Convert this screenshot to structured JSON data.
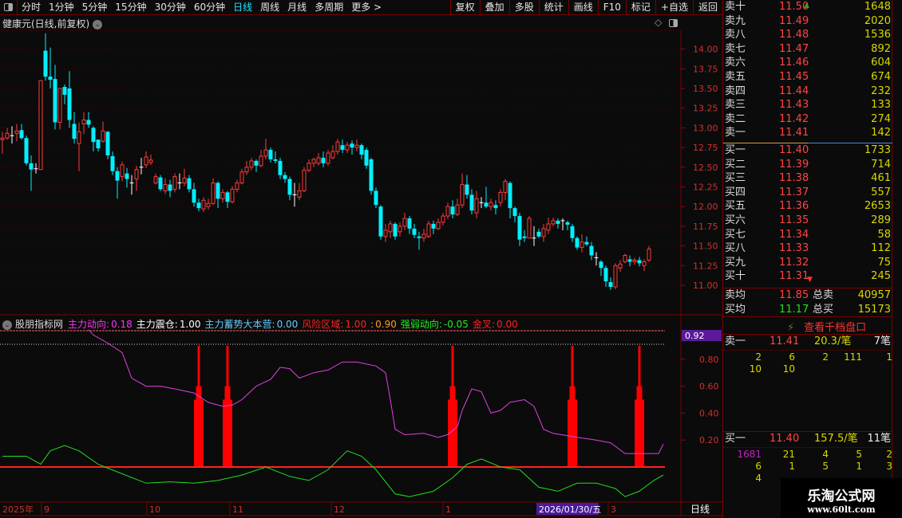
{
  "toolbar": {
    "periods": [
      "分时",
      "1分钟",
      "5分钟",
      "15分钟",
      "30分钟",
      "60分钟",
      "日线",
      "周线",
      "月线",
      "多周期",
      "更多 >"
    ],
    "active_period": "日线",
    "actions": [
      "复权",
      "叠加",
      "多股",
      "统计",
      "画线",
      "F10",
      "标记",
      "+自选",
      "返回"
    ]
  },
  "chart": {
    "title": "健康元(日线,前复权)",
    "y_ticks": [
      "14.00",
      "13.75",
      "13.50",
      "13.25",
      "13.00",
      "12.75",
      "12.50",
      "12.25",
      "12.00",
      "11.75",
      "11.50",
      "11.25",
      "11.00"
    ]
  },
  "indicator": {
    "name": "股朋指标网",
    "items": [
      {
        "label": "主力动向:",
        "value": "0.18",
        "color": "#ff33ff"
      },
      {
        "label": "主力震仓:",
        "value": "1.00",
        "color": "#ffffff"
      },
      {
        "label": "主力蓄势大本营:",
        "value": "0.00",
        "color": "#66ccff"
      },
      {
        "label": "风险区域:",
        "value": "1.00",
        "color": "#ff2222"
      },
      {
        "label": ":",
        "value": "0.90",
        "color": "#ff9922"
      },
      {
        "label": "强弱动向:",
        "value": "-0.05",
        "color": "#22ee22"
      },
      {
        "label": "金叉:",
        "value": "0.00",
        "color": "#ff2222"
      }
    ],
    "y_ticks": [
      "0.80",
      "0.60",
      "0.40",
      "0.20"
    ],
    "current_label": "0.92"
  },
  "date_axis": {
    "labels": [
      "2025年",
      "9",
      "10",
      "11",
      "12",
      "1",
      "3"
    ],
    "cursor_date": "2026/01/30/五",
    "period": "日线"
  },
  "chart_data": {
    "type": "candlestick",
    "title": "健康元(日线,前复权)",
    "ylim": [
      10.8,
      14.3
    ],
    "colors": {
      "up": "#ff3b3b",
      "down": "#00f0ff",
      "doji": "#ffffff",
      "main_force": "#e040e0",
      "strength": "#22dd22",
      "spike": "#ff0000"
    },
    "candles": [
      [
        12.85,
        12.87,
        12.95,
        12.67
      ],
      [
        12.87,
        12.93,
        13.0,
        12.85
      ],
      [
        12.9,
        12.9,
        13.02,
        12.8
      ],
      [
        12.93,
        12.96,
        13.05,
        12.83
      ],
      [
        12.97,
        12.87,
        13.05,
        12.85
      ],
      [
        12.87,
        12.55,
        12.9,
        12.52
      ],
      [
        12.55,
        12.47,
        12.65,
        12.2
      ],
      [
        12.48,
        12.48,
        12.55,
        12.42
      ],
      [
        12.47,
        13.6,
        13.6,
        12.47
      ],
      [
        13.98,
        13.65,
        14.2,
        13.6
      ],
      [
        13.65,
        13.61,
        14.02,
        13.5
      ],
      [
        13.62,
        13.07,
        13.8,
        12.98
      ],
      [
        13.07,
        13.5,
        13.5,
        12.98
      ],
      [
        13.52,
        13.42,
        13.55,
        13.3
      ],
      [
        13.5,
        13.1,
        13.72,
        13.0
      ],
      [
        13.05,
        12.86,
        13.2,
        12.8
      ],
      [
        12.8,
        12.95,
        13.07,
        12.45
      ],
      [
        13.05,
        13.1,
        13.2,
        12.92
      ],
      [
        13.1,
        13.04,
        13.2,
        13.0
      ],
      [
        13.0,
        12.82,
        13.02,
        12.7
      ],
      [
        12.85,
        12.74,
        12.85,
        12.7
      ],
      [
        12.83,
        12.96,
        13.08,
        12.81
      ],
      [
        12.95,
        12.65,
        12.96,
        12.6
      ],
      [
        12.64,
        12.45,
        12.7,
        12.4
      ],
      [
        12.45,
        12.33,
        12.5,
        12.1
      ],
      [
        12.38,
        12.53,
        12.57,
        12.32
      ],
      [
        12.42,
        12.35,
        12.49,
        12.24
      ],
      [
        12.3,
        12.3,
        12.4,
        12.15
      ],
      [
        12.35,
        12.47,
        12.52,
        12.2
      ],
      [
        12.5,
        12.5,
        12.62,
        12.41
      ],
      [
        12.53,
        12.63,
        12.7,
        12.49
      ],
      [
        12.56,
        12.59,
        12.66,
        12.53
      ],
      [
        12.3,
        12.38,
        12.42,
        12.28
      ],
      [
        12.37,
        12.22,
        12.4,
        12.2
      ],
      [
        12.2,
        12.28,
        12.36,
        12.16
      ],
      [
        12.28,
        12.2,
        12.34,
        12.12
      ],
      [
        12.22,
        12.38,
        12.42,
        12.18
      ],
      [
        12.3,
        12.3,
        12.42,
        12.22
      ],
      [
        12.3,
        12.36,
        12.48,
        12.26
      ],
      [
        12.36,
        12.22,
        12.4,
        12.18
      ],
      [
        12.22,
        12.05,
        12.3,
        12.0
      ],
      [
        12.05,
        11.98,
        12.1,
        11.94
      ],
      [
        11.97,
        12.08,
        12.12,
        11.93
      ],
      [
        12.0,
        12.04,
        12.1,
        11.96
      ],
      [
        12.04,
        12.3,
        12.36,
        12.02
      ],
      [
        12.3,
        12.1,
        12.32,
        11.98
      ],
      [
        12.1,
        12.18,
        12.22,
        12.05
      ],
      [
        12.18,
        12.06,
        12.2,
        11.98
      ],
      [
        12.06,
        12.22,
        12.26,
        12.04
      ],
      [
        12.22,
        12.3,
        12.34,
        12.18
      ],
      [
        12.3,
        12.44,
        12.48,
        12.28
      ],
      [
        12.44,
        12.5,
        12.58,
        12.4
      ],
      [
        12.5,
        12.58,
        12.62,
        12.46
      ],
      [
        12.58,
        12.52,
        12.6,
        12.44
      ],
      [
        12.52,
        12.64,
        12.72,
        12.5
      ],
      [
        12.64,
        12.72,
        12.86,
        12.6
      ],
      [
        12.72,
        12.6,
        12.75,
        12.56
      ],
      [
        12.6,
        12.58,
        12.7,
        12.55
      ],
      [
        12.58,
        12.4,
        12.62,
        12.35
      ],
      [
        12.4,
        12.35,
        12.44,
        12.3
      ],
      [
        12.35,
        12.15,
        12.38,
        12.08
      ],
      [
        12.15,
        12.15,
        12.3,
        12.0
      ],
      [
        12.12,
        12.2,
        12.3,
        12.08
      ],
      [
        12.2,
        12.46,
        12.5,
        12.18
      ],
      [
        12.46,
        12.55,
        12.6,
        12.44
      ],
      [
        12.55,
        12.6,
        12.62,
        12.5
      ],
      [
        12.55,
        12.62,
        12.68,
        12.52
      ],
      [
        12.62,
        12.55,
        12.7,
        12.5
      ],
      [
        12.55,
        12.68,
        12.72,
        12.52
      ],
      [
        12.62,
        12.7,
        12.78,
        12.6
      ],
      [
        12.7,
        12.82,
        12.86,
        12.66
      ],
      [
        12.78,
        12.72,
        12.85,
        12.68
      ],
      [
        12.72,
        12.78,
        12.82,
        12.68
      ],
      [
        12.8,
        12.75,
        12.84,
        12.66
      ],
      [
        12.75,
        12.78,
        12.85,
        12.7
      ],
      [
        12.78,
        12.66,
        12.8,
        12.6
      ],
      [
        12.72,
        12.52,
        12.75,
        12.48
      ],
      [
        12.6,
        12.2,
        12.62,
        12.15
      ],
      [
        12.2,
        12.02,
        12.24,
        11.98
      ],
      [
        12.0,
        11.62,
        12.02,
        11.58
      ],
      [
        11.62,
        11.7,
        11.78,
        11.55
      ],
      [
        11.68,
        11.78,
        11.82,
        11.6
      ],
      [
        11.78,
        11.62,
        11.8,
        11.58
      ],
      [
        11.68,
        11.75,
        11.8,
        11.62
      ],
      [
        11.75,
        11.85,
        11.92,
        11.7
      ],
      [
        11.85,
        11.72,
        11.88,
        11.65
      ],
      [
        11.72,
        11.64,
        11.78,
        11.6
      ],
      [
        11.62,
        11.6,
        11.68,
        11.45
      ],
      [
        11.6,
        11.65,
        11.72,
        11.55
      ],
      [
        11.62,
        11.78,
        11.82,
        11.6
      ],
      [
        11.78,
        11.72,
        11.82,
        11.65
      ],
      [
        11.72,
        11.8,
        11.85,
        11.7
      ],
      [
        11.8,
        11.88,
        11.92,
        11.76
      ],
      [
        11.88,
        12.0,
        12.05,
        11.84
      ],
      [
        12.0,
        11.9,
        12.08,
        11.85
      ],
      [
        11.9,
        12.02,
        12.1,
        11.88
      ],
      [
        12.02,
        12.28,
        12.42,
        11.98
      ],
      [
        12.28,
        12.15,
        12.4,
        12.1
      ],
      [
        12.15,
        11.95,
        12.22,
        11.9
      ],
      [
        11.92,
        12.1,
        12.2,
        11.85
      ],
      [
        12.05,
        12.05,
        12.12,
        11.98
      ],
      [
        12.05,
        12.0,
        12.25,
        11.98
      ],
      [
        12.0,
        12.05,
        12.1,
        11.95
      ],
      [
        12.02,
        11.98,
        12.08,
        11.9
      ],
      [
        12.05,
        12.18,
        12.22,
        12.0
      ],
      [
        12.18,
        12.32,
        12.35,
        12.08
      ],
      [
        12.3,
        11.98,
        12.32,
        11.85
      ],
      [
        11.98,
        11.88,
        12.0,
        11.8
      ],
      [
        11.88,
        11.58,
        11.92,
        11.5
      ],
      [
        11.62,
        11.6,
        11.7,
        11.55
      ],
      [
        11.6,
        11.85,
        11.88,
        11.62
      ],
      [
        11.6,
        11.6,
        11.75,
        11.5
      ],
      [
        11.68,
        11.62,
        11.72,
        11.6
      ],
      [
        11.62,
        11.72,
        11.78,
        11.55
      ],
      [
        11.7,
        11.78,
        11.86,
        11.65
      ],
      [
        11.78,
        11.82,
        11.86,
        11.75
      ],
      [
        11.82,
        11.78,
        11.85,
        11.72
      ],
      [
        11.82,
        11.82,
        11.85,
        11.7
      ],
      [
        11.8,
        11.77,
        11.82,
        11.7
      ],
      [
        11.75,
        11.6,
        11.78,
        11.55
      ],
      [
        11.6,
        11.48,
        11.62,
        11.45
      ],
      [
        11.48,
        11.55,
        11.65,
        11.42
      ],
      [
        11.55,
        11.52,
        11.62,
        11.5
      ],
      [
        11.5,
        11.38,
        11.55,
        11.32
      ],
      [
        11.35,
        11.35,
        11.42,
        11.25
      ],
      [
        11.3,
        11.22,
        11.32,
        11.12
      ],
      [
        11.22,
        11.05,
        11.25,
        10.98
      ],
      [
        11.04,
        10.98,
        11.1,
        10.94
      ],
      [
        10.98,
        11.25,
        11.28,
        10.95
      ],
      [
        11.22,
        11.27,
        11.32,
        11.17
      ],
      [
        11.3,
        11.38,
        11.4,
        11.28
      ],
      [
        11.33,
        11.3,
        11.38,
        11.24
      ],
      [
        11.3,
        11.32,
        11.35,
        11.26
      ],
      [
        11.32,
        11.28,
        11.36,
        11.24
      ],
      [
        11.25,
        11.3,
        11.33,
        11.18
      ],
      [
        11.32,
        11.46,
        11.5,
        11.3
      ]
    ],
    "main_force_trend": [
      [
        18,
        1.02
      ],
      [
        19,
        0.98
      ],
      [
        22,
        0.92
      ],
      [
        25,
        0.85
      ],
      [
        27,
        0.66
      ],
      [
        30,
        0.6
      ],
      [
        33,
        0.6
      ],
      [
        36,
        0.58
      ],
      [
        40,
        0.55
      ],
      [
        43,
        0.48
      ],
      [
        46,
        0.45
      ],
      [
        48,
        0.46
      ],
      [
        50,
        0.5
      ],
      [
        53,
        0.6
      ],
      [
        56,
        0.65
      ],
      [
        58,
        0.74
      ],
      [
        60,
        0.73
      ],
      [
        62,
        0.66
      ],
      [
        65,
        0.7
      ],
      [
        68,
        0.72
      ],
      [
        71,
        0.78
      ],
      [
        74,
        0.78
      ],
      [
        78,
        0.75
      ],
      [
        80,
        0.7
      ],
      [
        81,
        0.5
      ],
      [
        82,
        0.28
      ],
      [
        84,
        0.24
      ],
      [
        88,
        0.25
      ],
      [
        91,
        0.22
      ],
      [
        93,
        0.24
      ],
      [
        95,
        0.3
      ],
      [
        96,
        0.42
      ],
      [
        98,
        0.58
      ],
      [
        100,
        0.56
      ],
      [
        102,
        0.4
      ],
      [
        104,
        0.42
      ],
      [
        106,
        0.48
      ],
      [
        109,
        0.5
      ],
      [
        111,
        0.45
      ],
      [
        113,
        0.28
      ],
      [
        115,
        0.25
      ],
      [
        120,
        0.22
      ],
      [
        124,
        0.2
      ],
      [
        127,
        0.18
      ],
      [
        130,
        0.1
      ],
      [
        137,
        0.1
      ],
      [
        138,
        0.17
      ]
    ],
    "strength_trend": [
      [
        0,
        0.08
      ],
      [
        5,
        0.08
      ],
      [
        8,
        0.02
      ],
      [
        10,
        0.12
      ],
      [
        13,
        0.16
      ],
      [
        16,
        0.12
      ],
      [
        20,
        0.02
      ],
      [
        25,
        -0.05
      ],
      [
        30,
        -0.12
      ],
      [
        35,
        -0.11
      ],
      [
        40,
        -0.12
      ],
      [
        45,
        -0.1
      ],
      [
        50,
        -0.06
      ],
      [
        55,
        0.0
      ],
      [
        60,
        -0.07
      ],
      [
        64,
        -0.1
      ],
      [
        68,
        -0.02
      ],
      [
        72,
        0.12
      ],
      [
        75,
        0.08
      ],
      [
        78,
        -0.02
      ],
      [
        82,
        -0.2
      ],
      [
        85,
        -0.22
      ],
      [
        90,
        -0.18
      ],
      [
        94,
        -0.08
      ],
      [
        97,
        0.02
      ],
      [
        100,
        0.06
      ],
      [
        104,
        0.0
      ],
      [
        108,
        -0.02
      ],
      [
        112,
        -0.15
      ],
      [
        116,
        -0.18
      ],
      [
        120,
        -0.12
      ],
      [
        124,
        -0.12
      ],
      [
        128,
        -0.16
      ],
      [
        130,
        -0.22
      ],
      [
        133,
        -0.18
      ],
      [
        136,
        -0.1
      ],
      [
        138,
        -0.06
      ]
    ],
    "spikes": [
      41,
      47,
      94,
      119,
      133
    ],
    "spike_levels": {
      "top": 0.9,
      "base": 0.5
    },
    "indicator_ylim": [
      -0.26,
      1.05
    ]
  },
  "order_book": {
    "asks": [
      {
        "label": "卖十",
        "price": "11.50",
        "vol": "1648"
      },
      {
        "label": "卖九",
        "price": "11.49",
        "vol": "2020"
      },
      {
        "label": "卖八",
        "price": "11.48",
        "vol": "1536"
      },
      {
        "label": "卖七",
        "price": "11.47",
        "vol": "892"
      },
      {
        "label": "卖六",
        "price": "11.46",
        "vol": "604"
      },
      {
        "label": "卖五",
        "price": "11.45",
        "vol": "674"
      },
      {
        "label": "卖四",
        "price": "11.44",
        "vol": "232"
      },
      {
        "label": "卖三",
        "price": "11.43",
        "vol": "133"
      },
      {
        "label": "卖二",
        "price": "11.42",
        "vol": "274"
      },
      {
        "label": "卖一",
        "price": "11.41",
        "vol": "142"
      }
    ],
    "bids": [
      {
        "label": "买一",
        "price": "11.40",
        "vol": "1733"
      },
      {
        "label": "买二",
        "price": "11.39",
        "vol": "714"
      },
      {
        "label": "买三",
        "price": "11.38",
        "vol": "461"
      },
      {
        "label": "买四",
        "price": "11.37",
        "vol": "557"
      },
      {
        "label": "买五",
        "price": "11.36",
        "vol": "2653"
      },
      {
        "label": "买六",
        "price": "11.35",
        "vol": "289"
      },
      {
        "label": "买七",
        "price": "11.34",
        "vol": "58"
      },
      {
        "label": "买八",
        "price": "11.33",
        "vol": "112"
      },
      {
        "label": "买九",
        "price": "11.32",
        "vol": "75"
      },
      {
        "label": "买十",
        "price": "11.31",
        "vol": "245"
      }
    ],
    "avg_ask": {
      "label": "卖均",
      "price": "11.85",
      "total_label": "总卖",
      "total": "40957"
    },
    "avg_bid": {
      "label": "买均",
      "price": "11.17",
      "total_label": "总买",
      "total": "15173"
    },
    "thousand_level_link": "查看千档盘口",
    "ask1_queue": {
      "label": "卖一",
      "price": "11.41",
      "avg": "20.3/笔",
      "count": "7笔",
      "orders": [
        "2",
        "6",
        "2",
        "111",
        "1",
        "10",
        "10"
      ]
    },
    "bid1_queue": {
      "label": "买一",
      "price": "11.40",
      "avg": "157.5/笔",
      "count": "11笔",
      "orders": [
        "1681",
        "21",
        "4",
        "5",
        "2",
        "6",
        "1",
        "5",
        "1",
        "3",
        "4"
      ]
    }
  },
  "watermark": {
    "title": "乐淘公式网",
    "url": "www.60lt.com"
  }
}
